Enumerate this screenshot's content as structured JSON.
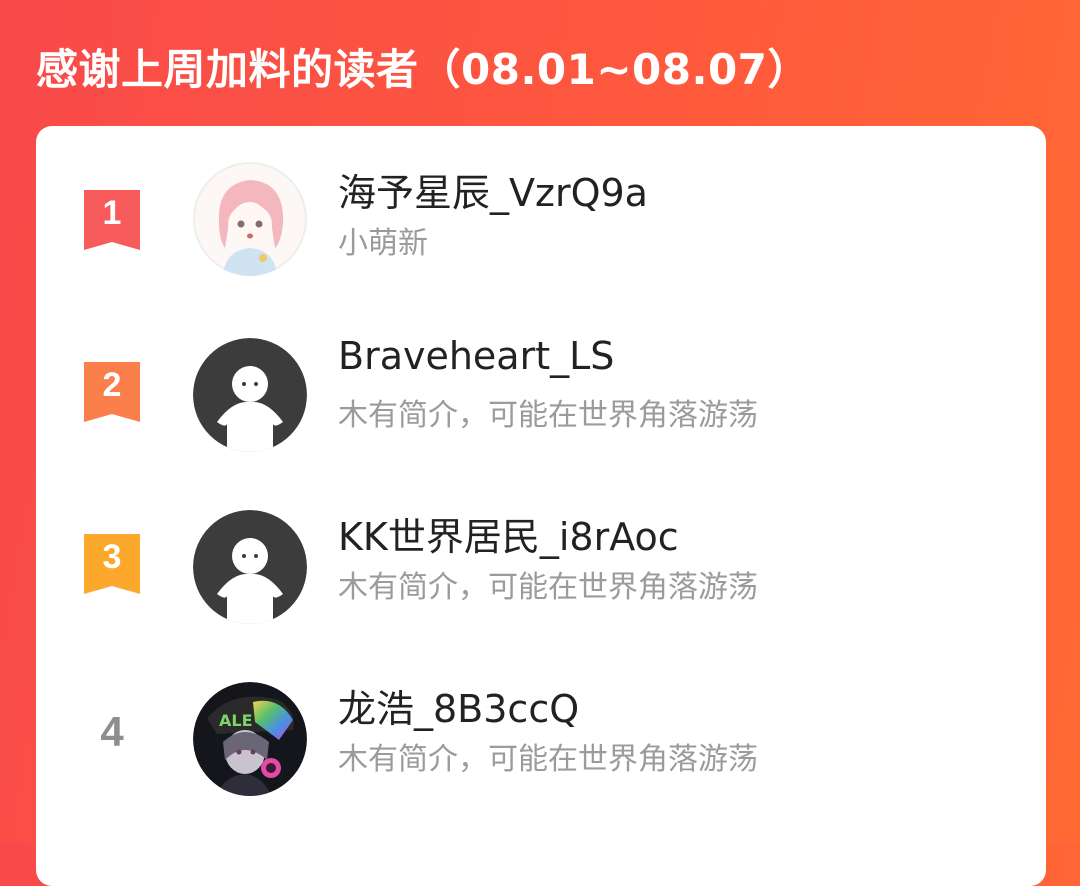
{
  "header": {
    "title": "感谢上周加料的读者（08.01~08.07）"
  },
  "readers": [
    {
      "rank": "1",
      "name": "海予星辰_VzrQ9a",
      "bio": "小萌新",
      "rank_color": "#f75b5b",
      "avatar": "anime-girl-avatar"
    },
    {
      "rank": "2",
      "name": "Braveheart_LS",
      "bio": "木有简介，可能在世界角落游荡",
      "rank_color": "#fb7f4a",
      "avatar": "default-avatar"
    },
    {
      "rank": "3",
      "name": "KK世界居民_i8rAoc",
      "bio": "木有简介，可能在世界角落游荡",
      "rank_color": "#fca82c",
      "avatar": "default-avatar"
    },
    {
      "rank": "4",
      "name": "龙浩_8B3ccQ",
      "bio": "木有简介，可能在世界角落游荡",
      "rank_color": "#8e8e8e",
      "avatar": "anime-boy-headphones-avatar"
    }
  ]
}
